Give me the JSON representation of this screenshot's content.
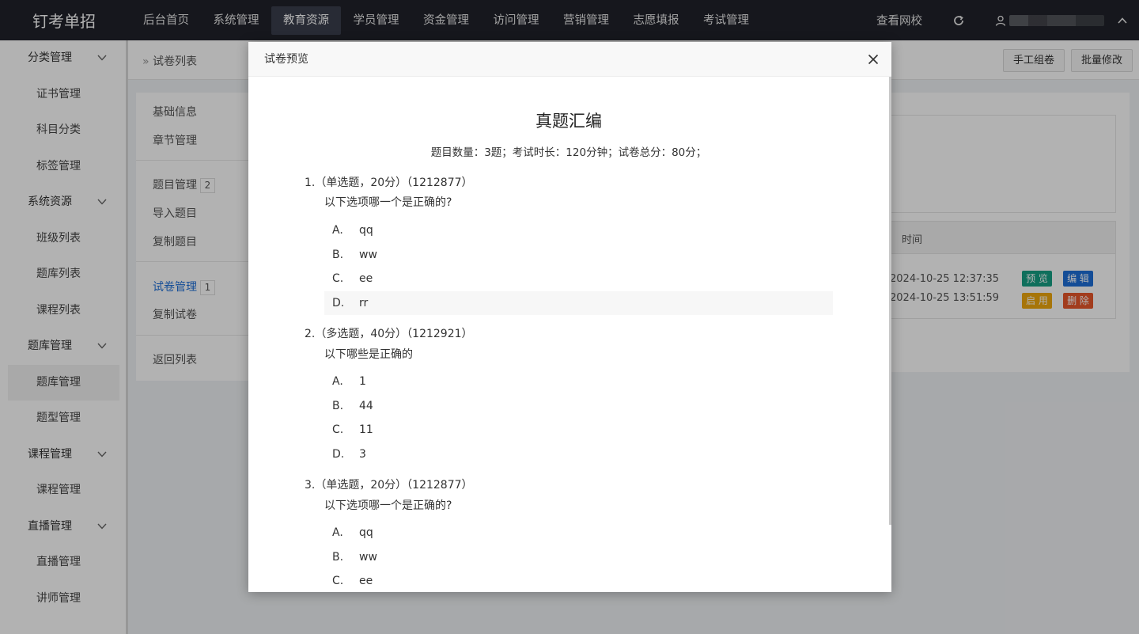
{
  "brand": "钉考单招",
  "topnav": [
    "后台首页",
    "系统管理",
    "教育资源",
    "学员管理",
    "资金管理",
    "访问管理",
    "营销管理",
    "志愿填报",
    "考试管理"
  ],
  "topnav_active": "教育资源",
  "top_right": {
    "site_link": "查看网校"
  },
  "sidebar": {
    "groups": [
      {
        "label": "分类管理",
        "items": [
          "证书管理",
          "科目分类",
          "标签管理"
        ]
      },
      {
        "label": "系统资源",
        "items": [
          "班级列表",
          "题库列表",
          "课程列表"
        ]
      },
      {
        "label": "题库管理",
        "items": [
          "题库管理",
          "题型管理"
        ]
      },
      {
        "label": "课程管理",
        "items": [
          "课程管理"
        ]
      },
      {
        "label": "直播管理",
        "items": [
          "直播管理",
          "讲师管理"
        ]
      }
    ],
    "active_item": "题库管理"
  },
  "breadcrumb": "试卷列表",
  "actions": {
    "manual_compose": "手工组卷",
    "batch_edit": "批量修改"
  },
  "leftpanel": {
    "basic_info": "基础信息",
    "chapter": "章节管理",
    "question_mgmt": "题目管理",
    "question_count": "2",
    "import": "导入题目",
    "copy_question": "复制题目",
    "paper_mgmt": "试卷管理",
    "paper_count": "1",
    "copy_paper": "复制试卷",
    "back": "返回列表"
  },
  "table": {
    "time_header": "时间",
    "rows": [
      {
        "time": "2024-10-25 12:37:35"
      },
      {
        "time": "2024-10-25 13:51:59"
      }
    ],
    "buttons": {
      "preview": "预 览",
      "edit": "编 辑",
      "enable": "启 用",
      "delete": "删 除"
    },
    "colors": {
      "preview": "#16a085",
      "edit": "#1e6fd9",
      "enable": "#f0a80e",
      "delete": "#e8562a"
    }
  },
  "modal": {
    "title": "试卷预览",
    "paper_title": "真题汇编",
    "meta": "题目数量：3题；考试时长：120分钟；试卷总分：80分；",
    "questions": [
      {
        "head": "1.（单选题，20分）（1212877）",
        "stem": "以下选项哪一个是正确的?",
        "options": [
          {
            "letter": "A.",
            "text": "qq"
          },
          {
            "letter": "B.",
            "text": "ww"
          },
          {
            "letter": "C.",
            "text": "ee"
          },
          {
            "letter": "D.",
            "text": "rr"
          }
        ]
      },
      {
        "head": "2.（多选题，40分）（1212921）",
        "stem": "以下哪些是正确的",
        "options": [
          {
            "letter": "A.",
            "text": "1"
          },
          {
            "letter": "B.",
            "text": "44"
          },
          {
            "letter": "C.",
            "text": "11"
          },
          {
            "letter": "D.",
            "text": "3"
          }
        ]
      },
      {
        "head": "3.（单选题，20分）（1212877）",
        "stem": "以下选项哪一个是正确的?",
        "options": [
          {
            "letter": "A.",
            "text": "qq"
          },
          {
            "letter": "B.",
            "text": "ww"
          },
          {
            "letter": "C.",
            "text": "ee"
          }
        ]
      }
    ]
  }
}
